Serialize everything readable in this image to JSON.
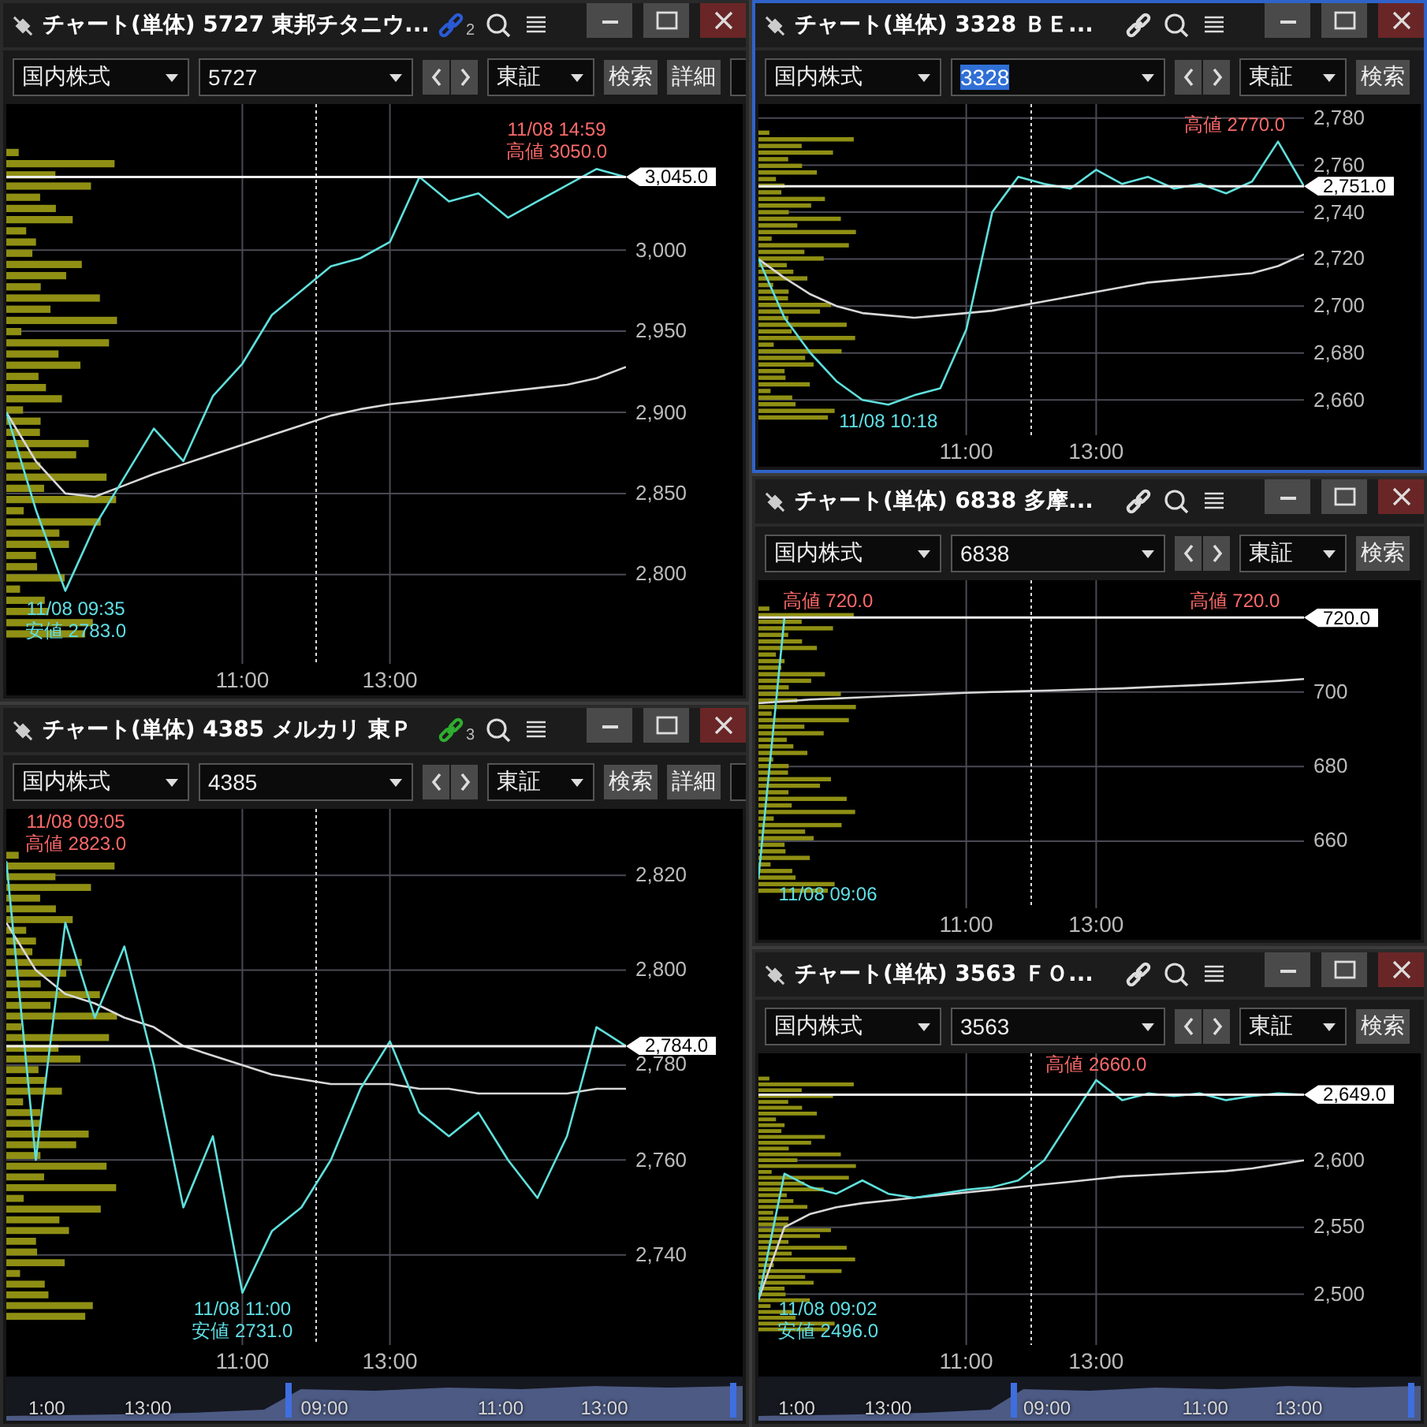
{
  "left_column": [
    {
      "title": "チャート(単体) 5727 東邦チタニウ...",
      "focused": false,
      "link": {
        "color": "#2a5bd7",
        "count": "2"
      },
      "toolbar": {
        "market": "国内株式",
        "code": {
          "value": "5727",
          "selected": false
        },
        "exchange": "東証",
        "buttons": [
          "検索",
          "詳細"
        ],
        "overflow": true
      },
      "chart_data": {
        "type": "line",
        "grid": true,
        "categories": [
          null,
          null,
          null,
          null,
          null,
          null,
          null,
          null,
          "11:00",
          null,
          null,
          null,
          null,
          "13:00",
          null,
          null,
          null,
          null,
          null,
          null,
          null,
          null
        ],
        "ylim": [
          2745,
          3090
        ],
        "series": [
          {
            "color": "#5fe0dc",
            "values": [
              2900,
              2840,
              2790,
              2830,
              2860,
              2890,
              2870,
              2910,
              2930,
              2960,
              2975,
              2990,
              2995,
              3005,
              3045,
              3030,
              3035,
              3020,
              3030,
              3040,
              3050,
              3045
            ]
          },
          {
            "color": "#d8d8d8",
            "values": [
              2900,
              2870,
              2850,
              2848,
              2855,
              2862,
              2868,
              2874,
              2880,
              2886,
              2892,
              2898,
              2902,
              2905,
              2907,
              2909,
              2911,
              2913,
              2915,
              2917,
              2921,
              2928
            ]
          }
        ],
        "yticks": [
          {
            "value": 3000,
            "label": "3,000"
          },
          {
            "value": 2950,
            "label": "2,950"
          },
          {
            "value": 2900,
            "label": "2,900"
          },
          {
            "value": 2850,
            "label": "2,850"
          },
          {
            "value": 2800,
            "label": "2,800"
          }
        ],
        "ref_lines": [
          {
            "axis": "y",
            "value": 3045
          }
        ]
      },
      "price_labels": [
        {
          "kind": "high",
          "lines": [
            "11/08 14:59",
            "高値 3050.0"
          ]
        },
        {
          "kind": "low",
          "lines": [
            "11/08 09:35",
            "安値 2783.0"
          ]
        }
      ],
      "price_tag": "3,045.0"
    },
    {
      "title": "チャート(単体) 4385 メルカリ 東Ｐ",
      "focused": false,
      "link": {
        "color": "#2fae2f",
        "count": "3"
      },
      "toolbar": {
        "market": "国内株式",
        "code": {
          "value": "4385",
          "selected": false
        },
        "exchange": "東証",
        "buttons": [
          "検索",
          "詳細"
        ],
        "overflow": true
      },
      "chart_data": {
        "type": "line",
        "grid": true,
        "categories": [
          null,
          null,
          null,
          null,
          null,
          null,
          null,
          null,
          "11:00",
          null,
          null,
          null,
          null,
          "13:00",
          null,
          null,
          null,
          null,
          null,
          null,
          null,
          null
        ],
        "ylim": [
          2721,
          2834
        ],
        "series": [
          {
            "color": "#5fe0dc",
            "values": [
              2823,
              2760,
              2810,
              2790,
              2805,
              2780,
              2750,
              2765,
              2732,
              2745,
              2750,
              2760,
              2775,
              2785,
              2770,
              2765,
              2770,
              2760,
              2752,
              2765,
              2788,
              2784
            ]
          },
          {
            "color": "#d8d8d8",
            "values": [
              2810,
              2800,
              2795,
              2793,
              2790,
              2788,
              2784,
              2782,
              2780,
              2778,
              2777,
              2776,
              2776,
              2776,
              2775,
              2775,
              2774,
              2774,
              2774,
              2774,
              2775,
              2775
            ]
          }
        ],
        "yticks": [
          {
            "value": 2820,
            "label": "2,820"
          },
          {
            "value": 2800,
            "label": "2,800"
          },
          {
            "value": 2780,
            "label": "2,780"
          },
          {
            "value": 2760,
            "label": "2,760"
          },
          {
            "value": 2740,
            "label": "2,740"
          }
        ],
        "ref_lines": [
          {
            "axis": "y",
            "value": 2784
          }
        ]
      },
      "price_labels": [
        {
          "kind": "high",
          "lines": [
            "11/08 09:05",
            "高値 2823.0"
          ]
        },
        {
          "kind": "low",
          "lines": [
            "11/08 11:00",
            "安値 2731.0"
          ]
        }
      ],
      "price_tag": "2,784.0",
      "navigator": {
        "labels": [
          "1:00",
          "13:00",
          "09:00",
          "11:00",
          "13:00"
        ]
      }
    }
  ],
  "right_column": [
    {
      "title": "チャート(単体) 3328 ＢＥ...",
      "focused": true,
      "link": {
        "color": "#dddddd"
      },
      "toolbar": {
        "market": "国内株式",
        "code": {
          "value": "3328",
          "selected": true
        },
        "exchange": "東証",
        "buttons": [
          "検索"
        ],
        "overflow": false
      },
      "chart_data": {
        "type": "line",
        "grid": true,
        "categories": [
          null,
          null,
          null,
          null,
          null,
          null,
          null,
          null,
          "11:00",
          null,
          null,
          null,
          null,
          "13:00",
          null,
          null,
          null,
          null,
          null,
          null,
          null,
          null
        ],
        "ylim": [
          2645,
          2786
        ],
        "series": [
          {
            "color": "#5fe0dc",
            "values": [
              2720,
              2695,
              2680,
              2668,
              2660,
              2658,
              2662,
              2665,
              2690,
              2740,
              2755,
              2752,
              2750,
              2758,
              2752,
              2755,
              2750,
              2752,
              2748,
              2753,
              2770,
              2751
            ]
          },
          {
            "color": "#d8d8d8",
            "values": [
              2720,
              2712,
              2705,
              2700,
              2697,
              2696,
              2695,
              2696,
              2697,
              2698,
              2700,
              2702,
              2704,
              2706,
              2708,
              2710,
              2711,
              2712,
              2713,
              2714,
              2717,
              2722
            ]
          }
        ],
        "yticks": [
          {
            "value": 2780,
            "label": "2,780"
          },
          {
            "value": 2760,
            "label": "2,760"
          },
          {
            "value": 2740,
            "label": "2,740"
          },
          {
            "value": 2720,
            "label": "2,720"
          },
          {
            "value": 2700,
            "label": "2,700"
          },
          {
            "value": 2680,
            "label": "2,680"
          },
          {
            "value": 2660,
            "label": "2,660"
          }
        ],
        "ref_lines": [
          {
            "axis": "y",
            "value": 2751
          }
        ]
      },
      "price_labels": [
        {
          "kind": "high",
          "lines": [
            "高値 2770.0"
          ]
        },
        {
          "kind": "low",
          "lines": [
            "11/08 10:18"
          ]
        }
      ],
      "price_tag": "2,751.0"
    },
    {
      "title": "チャート(単体) 6838 多摩...",
      "focused": false,
      "link": {
        "color": "#dddddd"
      },
      "toolbar": {
        "market": "国内株式",
        "code": {
          "value": "6838",
          "selected": false
        },
        "exchange": "東証",
        "buttons": [
          "検索"
        ],
        "overflow": false
      },
      "chart_data": {
        "type": "line",
        "grid": true,
        "categories": [
          null,
          null,
          null,
          null,
          null,
          null,
          null,
          null,
          "11:00",
          null,
          null,
          null,
          null,
          "13:00",
          null,
          null,
          null,
          null,
          null,
          null,
          null,
          null
        ],
        "ylim": [
          642,
          730
        ],
        "series": [
          {
            "color": "#5fe0dc",
            "values": [
              650,
              720,
              null,
              null,
              null,
              null,
              null,
              null,
              null,
              null,
              null,
              null,
              null,
              null,
              null,
              null,
              null,
              null,
              null,
              null,
              null,
              null
            ]
          },
          {
            "color": "#d8d8d8",
            "values": [
              697,
              697.5,
              698,
              698.3,
              698.6,
              698.9,
              699.2,
              699.5,
              699.8,
              700,
              700.2,
              700.4,
              700.6,
              700.8,
              701,
              701.3,
              701.6,
              701.9,
              702.2,
              702.6,
              703,
              703.5
            ]
          }
        ],
        "yticks": [
          {
            "value": 700,
            "label": "700"
          },
          {
            "value": 680,
            "label": "680"
          },
          {
            "value": 660,
            "label": "660"
          }
        ],
        "ref_lines": [
          {
            "axis": "y",
            "value": 720
          }
        ]
      },
      "price_labels": [
        {
          "kind": "high",
          "lines": [
            "高値 720.0"
          ]
        },
        {
          "kind": "high",
          "lines": [
            "高値 720.0"
          ]
        },
        {
          "kind": "low",
          "lines": [
            "11/08 09:06"
          ]
        }
      ],
      "price_tag": "720.0"
    },
    {
      "title": "チャート(単体) 3563 ＦＯ...",
      "focused": false,
      "link": {
        "color": "#dddddd"
      },
      "toolbar": {
        "market": "国内株式",
        "code": {
          "value": "3563",
          "selected": false
        },
        "exchange": "東証",
        "buttons": [
          "検索"
        ],
        "overflow": false
      },
      "chart_data": {
        "type": "line",
        "grid": true,
        "categories": [
          null,
          null,
          null,
          null,
          null,
          null,
          null,
          null,
          "11:00",
          null,
          null,
          null,
          null,
          "13:00",
          null,
          null,
          null,
          null,
          null,
          null,
          null,
          null
        ],
        "ylim": [
          2462,
          2680
        ],
        "series": [
          {
            "color": "#5fe0dc",
            "values": [
              2496,
              2590,
              2580,
              2575,
              2585,
              2575,
              2572,
              2575,
              2578,
              2580,
              2585,
              2600,
              2630,
              2660,
              2645,
              2650,
              2648,
              2650,
              2645,
              2648,
              2650,
              2649
            ]
          },
          {
            "color": "#d8d8d8",
            "values": [
              2496,
              2550,
              2560,
              2565,
              2568,
              2570,
              2572,
              2574,
              2576,
              2578,
              2580,
              2582,
              2584,
              2586,
              2588,
              2589,
              2590,
              2591,
              2592,
              2594,
              2597,
              2600
            ]
          }
        ],
        "yticks": [
          {
            "value": 2600,
            "label": "2,600"
          },
          {
            "value": 2550,
            "label": "2,550"
          },
          {
            "value": 2500,
            "label": "2,500"
          }
        ],
        "ref_lines": [
          {
            "axis": "y",
            "value": 2649
          }
        ]
      },
      "price_labels": [
        {
          "kind": "high",
          "lines": [
            "高値 2660.0"
          ]
        },
        {
          "kind": "low",
          "lines": [
            "11/08 09:02",
            "安値 2496.0"
          ]
        }
      ],
      "price_tag": "2,649.0",
      "navigator": {
        "labels": [
          "1:00",
          "13:00",
          "09:00",
          "11:00",
          "13:00"
        ]
      }
    }
  ]
}
